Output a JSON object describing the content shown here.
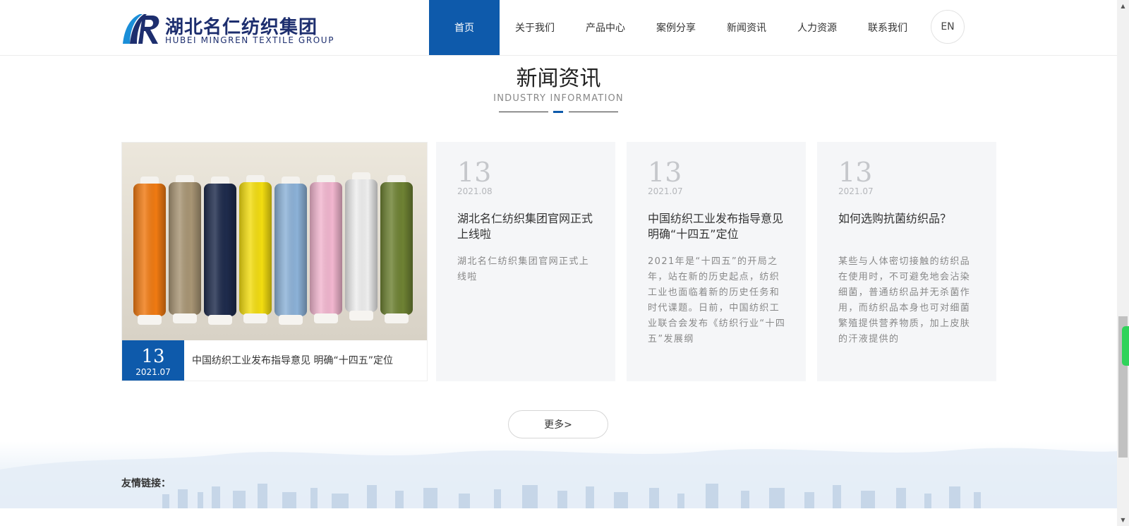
{
  "header": {
    "logo_cn": "湖北名仁纺织集团",
    "logo_en": "HUBEI MINGREN TEXTILE GROUP",
    "nav": [
      "首页",
      "关于我们",
      "产品中心",
      "案例分享",
      "新闻资讯",
      "人力资源",
      "联系我们"
    ],
    "active_nav": "首页",
    "lang": "EN"
  },
  "section": {
    "title": "新闻资讯",
    "subtitle": "INDUSTRY INFORMATION"
  },
  "featured": {
    "day": "13",
    "ym": "2021.07",
    "title": "中国纺织工业发布指导意见 明确“十四五”定位",
    "thread_colors": [
      "#f07a12",
      "#a89574",
      "#1e2b4c",
      "#f3dd10",
      "#8cb2d8",
      "#f2b6cf",
      "#eeeeee",
      "#6e8233"
    ]
  },
  "news": [
    {
      "day": "13",
      "ym": "2021.08",
      "title": "湖北名仁纺织集团官网正式上线啦",
      "desc": "湖北名仁纺织集团官网正式上线啦"
    },
    {
      "day": "13",
      "ym": "2021.07",
      "title": "中国纺织工业发布指导意见 明确“十四五”定位",
      "desc": "2021年是“十四五”的开局之年，站在新的历史起点，纺织工业也面临着新的历史任务和时代课题。日前，中国纺织工业联合会发布《纺织行业“十四五”发展纲"
    },
    {
      "day": "13",
      "ym": "2021.07",
      "title": "如何选购抗菌纺织品？",
      "desc": "某些与人体密切接触的纺织品在使用时，不可避免地会沾染细菌，普通纺织品并无杀菌作用，而纺织品本身也可对细菌繁殖提供营养物质，加上皮肤的汗液提供的"
    }
  ],
  "more_label": "更多>",
  "footer": {
    "links_label": "友情链接："
  },
  "colors": {
    "brand_blue": "#0e5aab",
    "logo_navy": "#1d2e6e"
  }
}
